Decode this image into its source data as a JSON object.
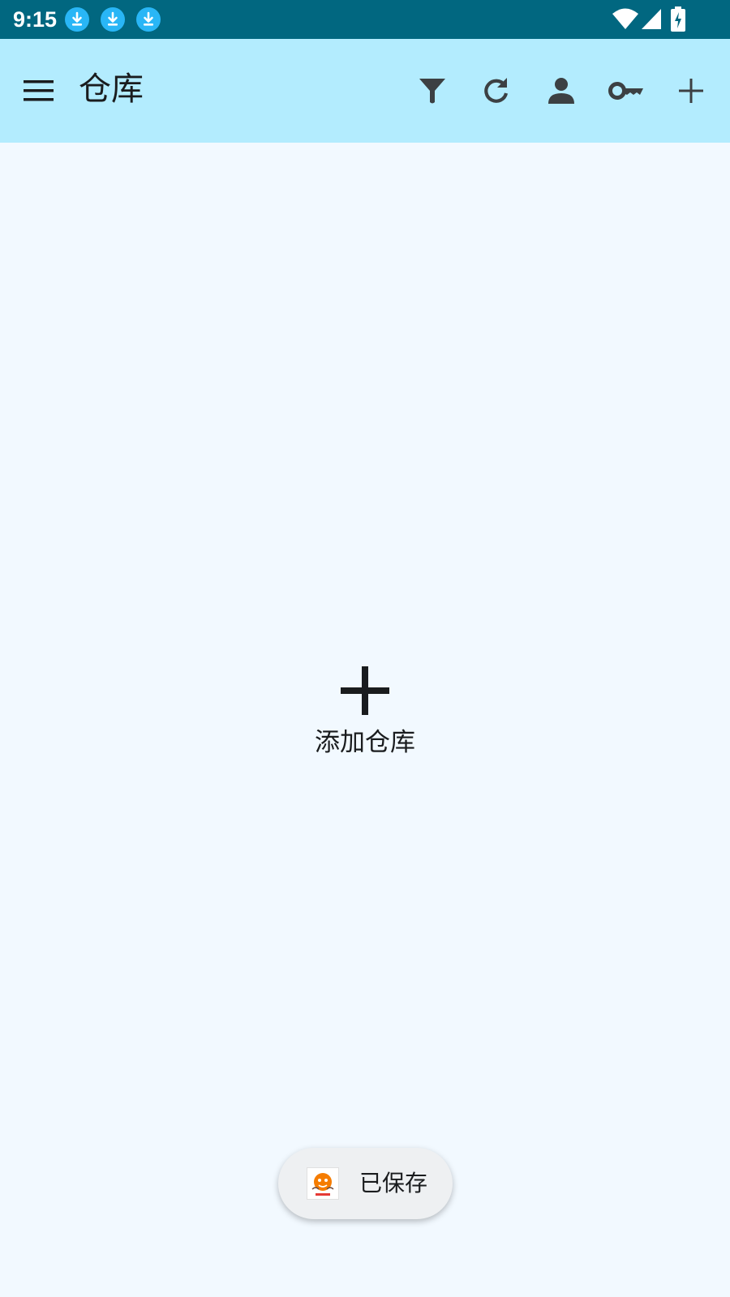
{
  "status_bar": {
    "time": "9:15",
    "icons": [
      "download-icon",
      "download-icon",
      "download-icon",
      "wifi-icon",
      "cell-signal-icon",
      "battery-charging-icon"
    ]
  },
  "app_bar": {
    "title": "仓库",
    "actions": [
      "filter-icon",
      "refresh-icon",
      "person-icon",
      "key-icon",
      "add-icon"
    ]
  },
  "empty_state": {
    "label": "添加仓库"
  },
  "toast": {
    "text": "已保存"
  },
  "colors": {
    "status_bar": "#016780",
    "app_bar": "#b3ecfe",
    "background": "#f2f9ff",
    "download_badge": "#29b6f6",
    "icon": "#3c4043"
  }
}
